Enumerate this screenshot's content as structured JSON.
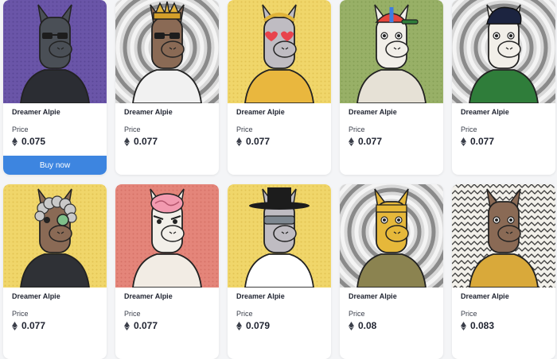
{
  "price_label": "Price",
  "currency_icon": "ethereum-icon",
  "buy_label": "Buy now",
  "accent_color": "#3d85e0",
  "items": [
    {
      "name": "Dreamer Alpie",
      "price": "0.075",
      "background": "purple-dots",
      "body": "dark",
      "outfit": "black-suit",
      "headwear": "none",
      "eyes": "sunglasses"
    },
    {
      "name": "Dreamer Alpie",
      "price": "0.077",
      "background": "gray-swirl",
      "body": "brown",
      "outfit": "white-robe",
      "headwear": "golden-crown",
      "eyes": "sunglasses"
    },
    {
      "name": "Dreamer Alpie",
      "price": "0.077",
      "background": "yellow-dots",
      "body": "gray",
      "outfit": "gold-chains",
      "headwear": "laurel",
      "eyes": "heart"
    },
    {
      "name": "Dreamer Alpie",
      "price": "0.077",
      "background": "green-dots",
      "body": "white",
      "outfit": "overalls",
      "headwear": "propeller-cap",
      "eyes": "normal"
    },
    {
      "name": "Dreamer Alpie",
      "price": "0.077",
      "background": "gray-swirl",
      "body": "white",
      "outfit": "leaf-shirt",
      "headwear": "pompadour",
      "eyes": "normal"
    },
    {
      "name": "Dreamer Alpie",
      "price": "0.077",
      "background": "yellow-dots",
      "body": "brown",
      "outfit": "black-tunic",
      "headwear": "gray-wig",
      "eyes": "monocle"
    },
    {
      "name": "Dreamer Alpie",
      "price": "0.077",
      "background": "red-dots",
      "body": "white",
      "outfit": "red-toga",
      "headwear": "brain",
      "eyes": "angry"
    },
    {
      "name": "Dreamer Alpie",
      "price": "0.079",
      "background": "yellow-dots",
      "body": "gray",
      "outfit": "white-shirt-tie",
      "headwear": "black-hat",
      "eyes": "visor"
    },
    {
      "name": "Dreamer Alpie",
      "price": "0.08",
      "background": "gray-swirl",
      "body": "gold",
      "outfit": "camo-jacket",
      "headwear": "gold-headband",
      "eyes": "normal"
    },
    {
      "name": "Dreamer Alpie",
      "price": "0.083",
      "background": "zigzag",
      "body": "brown",
      "outfit": "gold-armor",
      "headwear": "none",
      "eyes": "normal"
    }
  ]
}
